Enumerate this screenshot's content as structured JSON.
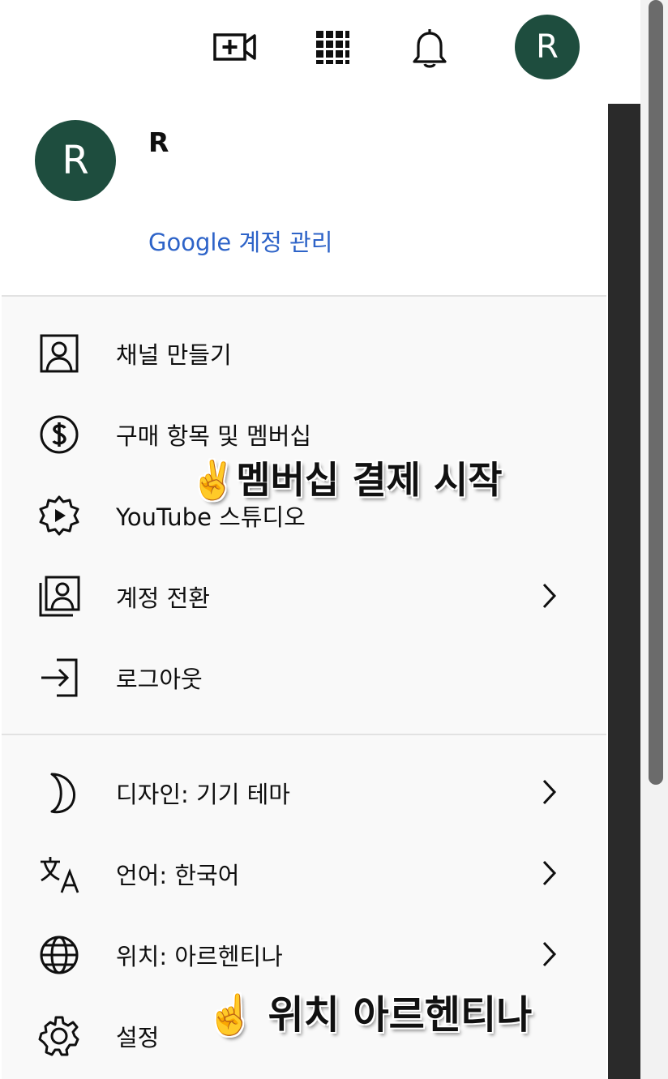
{
  "colors": {
    "avatar_bg": "#1e4d3e",
    "link": "#2d63c8",
    "panel_bg": "#f9f9f9",
    "divider": "#e2e2e2"
  },
  "topbar": {
    "create_icon": "video-camera-add-icon",
    "apps_icon": "apps-grid-icon",
    "notifications_icon": "bell-icon",
    "avatar_letter": "R"
  },
  "account": {
    "avatar_letter": "R",
    "name": "R",
    "manage_link": "Google 계정 관리"
  },
  "menu_section1": [
    {
      "label": "채널 만들기",
      "icon": "person-box-icon"
    },
    {
      "label": "구매 항목 및 멤버십",
      "icon": "dollar-circle-icon"
    },
    {
      "label": "YouTube 스튜디오",
      "icon": "studio-gear-play-icon"
    },
    {
      "label": "계정 전환",
      "icon": "switch-account-icon",
      "has_chevron": true
    },
    {
      "label": "로그아웃",
      "icon": "sign-out-icon"
    }
  ],
  "menu_section2": [
    {
      "label": "디자인: 기기 테마",
      "icon": "moon-icon",
      "has_chevron": true
    },
    {
      "label": "언어: 한국어",
      "icon": "translate-icon",
      "has_chevron": true
    },
    {
      "label": "위치: 아르헨티나",
      "icon": "globe-icon",
      "has_chevron": true
    },
    {
      "label": "설정",
      "icon": "settings-gear-icon"
    }
  ],
  "overlays": {
    "membership": {
      "emoji": "✌️",
      "text": "멤버십 결제 시작"
    },
    "location": {
      "emoji": "☝️",
      "text": " 위치 아르헨티나"
    }
  }
}
